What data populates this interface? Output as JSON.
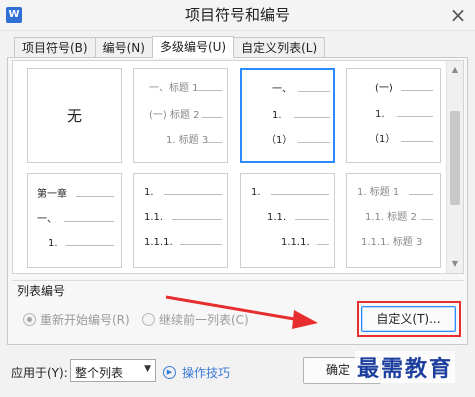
{
  "window": {
    "app_logo": "W",
    "title": "项目符号和编号",
    "close_glyph": "×"
  },
  "tabs": [
    {
      "label": "项目符号(B)",
      "active": false
    },
    {
      "label": "编号(N)",
      "active": false
    },
    {
      "label": "多级编号(U)",
      "active": true
    },
    {
      "label": "自定义列表(L)",
      "active": false
    }
  ],
  "gallery": {
    "none_label": "无",
    "cells": [
      {
        "lines": []
      },
      {
        "lines": [
          {
            "text": "一、标题 1"
          },
          {
            "text": "(一) 标题 2"
          },
          {
            "text": "1. 标题 3"
          }
        ]
      },
      {
        "lines": [
          {
            "text": "一、"
          },
          {
            "text": "1."
          },
          {
            "text": "（1）"
          }
        ]
      },
      {
        "lines": [
          {
            "text": "(一)"
          },
          {
            "text": "1."
          },
          {
            "text": "（1）"
          }
        ]
      },
      {
        "lines": [
          {
            "text": "第一章"
          },
          {
            "text": "一、"
          },
          {
            "text": "1."
          }
        ]
      },
      {
        "lines": [
          {
            "text": "1."
          },
          {
            "text": "1.1."
          },
          {
            "text": "1.1.1."
          }
        ]
      },
      {
        "lines": [
          {
            "text": "1."
          },
          {
            "text": "1.1."
          },
          {
            "text": "1.1.1."
          }
        ]
      },
      {
        "lines": [
          {
            "text": "1. 标题 1"
          },
          {
            "text": "1.1. 标题 2"
          },
          {
            "text": "1.1.1. 标题 3"
          }
        ]
      }
    ],
    "selected_index": 2
  },
  "list_numbering": {
    "section_label": "列表编号",
    "restart_label": "重新开始编号(R)",
    "continue_label": "继续前一列表(C)",
    "customize_button": "自定义(T)..."
  },
  "footer": {
    "apply_label": "应用于(Y):",
    "apply_value": "整个列表",
    "tips_icon": "▶",
    "tips_link": "操作技巧",
    "ok_button": "确定"
  },
  "watermark": "最需教育",
  "annotation": {
    "box_color": "#e62e2e",
    "arrow_color": "#e62e2e"
  }
}
